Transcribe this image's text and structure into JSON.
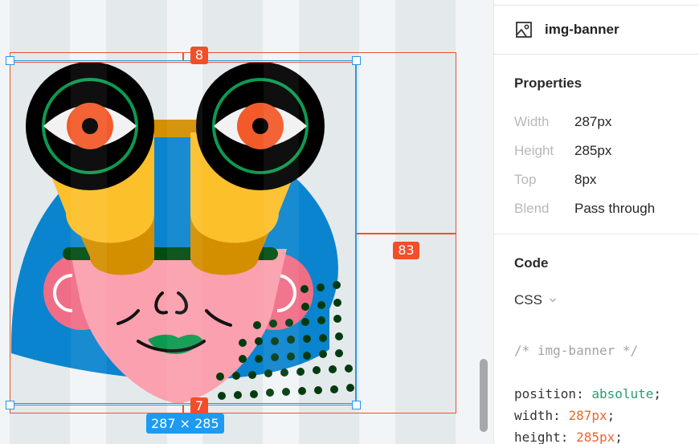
{
  "canvas": {
    "spacing_top": "8",
    "spacing_right": "83",
    "spacing_bottom": "7",
    "selection_size": "287 × 285",
    "colors": {
      "measure": "#f0512a",
      "selection": "#1e9bf0",
      "column_dark": "#e4e9ec",
      "column_light": "#f1f5f8"
    }
  },
  "panel": {
    "layer": {
      "icon": "image-icon",
      "name": "img-banner"
    },
    "properties": {
      "title": "Properties",
      "rows": [
        {
          "label": "Width",
          "value": "287px"
        },
        {
          "label": "Height",
          "value": "285px"
        },
        {
          "label": "Top",
          "value": "8px"
        },
        {
          "label": "Blend",
          "value": "Pass through"
        }
      ]
    },
    "code": {
      "title": "Code",
      "language": "CSS",
      "language_icon": "chevron-down-icon",
      "comment": "/* img-banner */",
      "lines": [
        {
          "prop": "position",
          "value": "absolute",
          "kind": "keyword"
        },
        {
          "prop": "width",
          "value": "287px",
          "kind": "number"
        },
        {
          "prop": "height",
          "value": "285px",
          "kind": "number"
        }
      ]
    }
  }
}
